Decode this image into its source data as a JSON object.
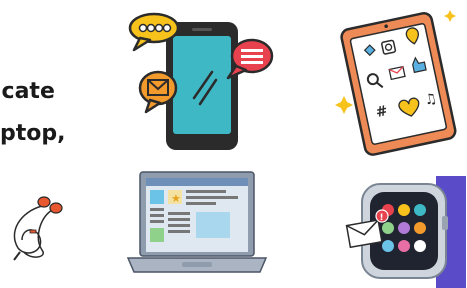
{
  "text": {
    "line1": "icate",
    "line2": "ptop,"
  },
  "icons": {
    "phone": "smartphone-chat-icon",
    "tablet": "tablet-social-icon",
    "earphones": "earphones-icon",
    "laptop": "laptop-icon",
    "watch": "smartwatch-icon"
  },
  "colors": {
    "phone_screen": "#3fb8c5",
    "bubble_yellow": "#f6c21b",
    "bubble_red": "#e8424e",
    "bubble_orange": "#f39a2c",
    "tablet_frame": "#ee8a55",
    "watch_band": "#5a4bc9",
    "laptop_screen": "#6e8fb8"
  }
}
